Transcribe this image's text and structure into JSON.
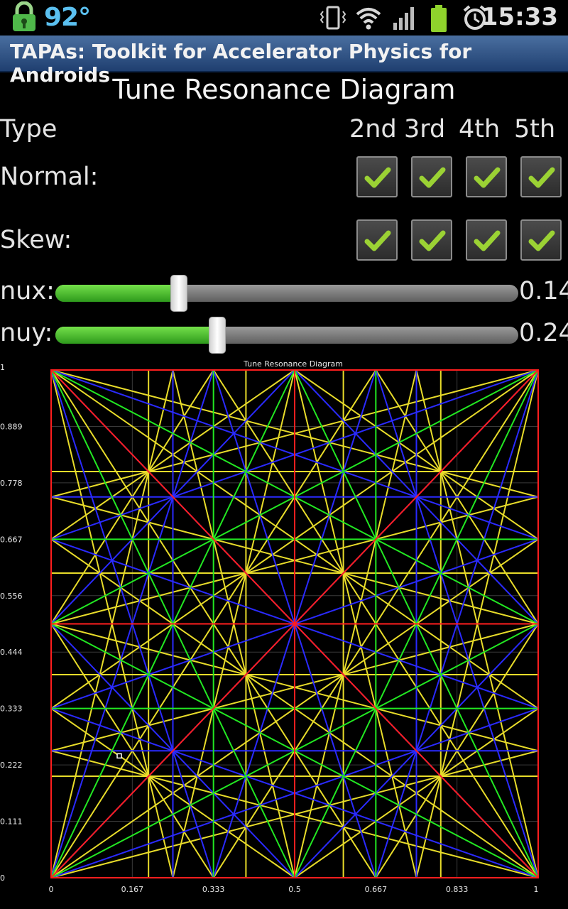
{
  "status_bar": {
    "battery_percent": "92°",
    "time": "15:33",
    "icons": [
      "lock-icon",
      "vibrate-icon",
      "wifi-icon",
      "signal-icon",
      "battery-icon",
      "alarm-icon"
    ]
  },
  "app": {
    "title": "TAPAs: Toolkit for Accelerator Physics for Androids"
  },
  "screen": {
    "heading": "Tune Resonance Diagram"
  },
  "controls": {
    "type_label": "Type",
    "columns": [
      "2nd",
      "3rd",
      "4th",
      "5th"
    ],
    "normal_label": "Normal:",
    "skew_label": "Skew:",
    "normal_checked": [
      true,
      true,
      true,
      true
    ],
    "skew_checked": [
      true,
      true,
      true,
      true
    ],
    "check_color": "#9bd234",
    "nux": {
      "label": "nux:",
      "value": "0.14",
      "fraction": 0.14
    },
    "nuy": {
      "label": "nuy:",
      "value": "0.24",
      "fraction": 0.24
    }
  },
  "chart_data": {
    "type": "line",
    "title": "Tune Resonance Diagram",
    "xlabel": "",
    "ylabel": "",
    "xlim": [
      0,
      1
    ],
    "ylim": [
      0,
      1
    ],
    "x_ticks": [
      "0",
      "0.167",
      "0.333",
      "0.5",
      "0.667",
      "0.833",
      "1"
    ],
    "y_ticks": [
      "1",
      "0.889",
      "0.778",
      "0.667",
      "0.556",
      "0.444",
      "0.333",
      "0.222",
      "0.111",
      "0"
    ],
    "grid": true,
    "resonance_orders": [
      {
        "order": 2,
        "color": "#ff1e1e"
      },
      {
        "order": 3,
        "color": "#22e822"
      },
      {
        "order": 4,
        "color": "#2a2aff"
      },
      {
        "order": 5,
        "color": "#e8dc2a"
      }
    ],
    "operating_point": {
      "x": 0.14,
      "y": 0.24
    }
  }
}
